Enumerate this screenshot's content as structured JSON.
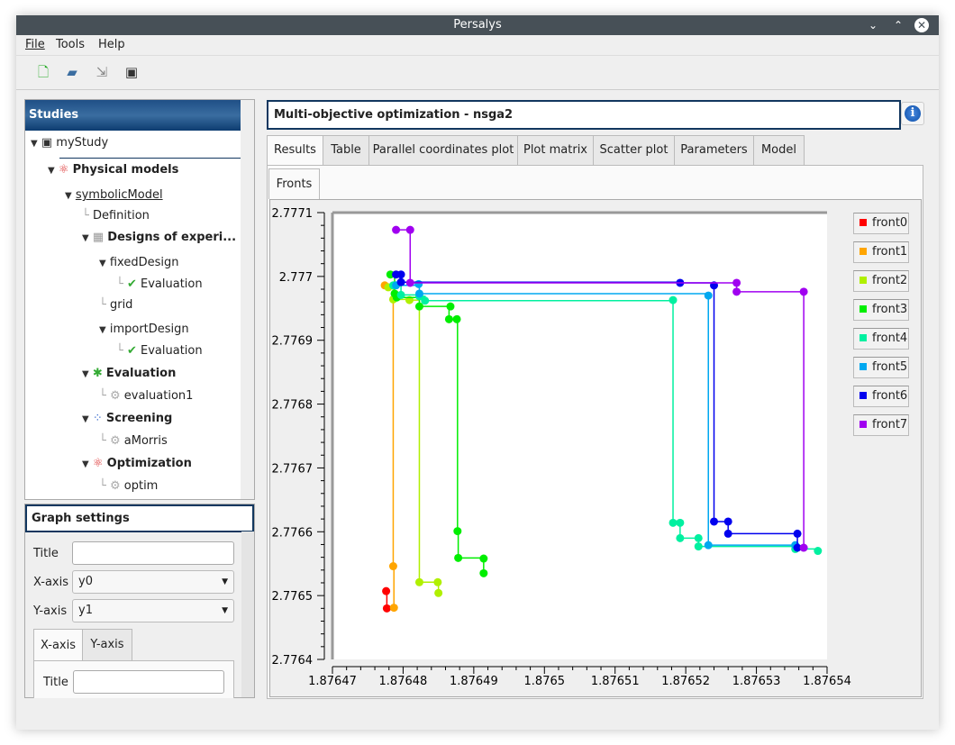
{
  "window": {
    "title": "Persalys"
  },
  "menu": [
    "File",
    "Tools",
    "Help"
  ],
  "toolbar": [
    "new-study-icon",
    "open-study-icon",
    "import-icon",
    "save-icon"
  ],
  "studies": {
    "header": "Studies",
    "items": [
      {
        "label": "myStudy",
        "level": 0,
        "icon": "save-icon",
        "bold": false
      },
      {
        "label": "Physical models",
        "level": 1,
        "icon": "atom-icon",
        "bold": true
      },
      {
        "label": "symbolicModel",
        "level": 2,
        "icon": "",
        "bold": false,
        "underline": true
      },
      {
        "label": "Definition",
        "level": 3,
        "icon": "",
        "bold": false
      },
      {
        "label": "Designs of experi...",
        "level": 3,
        "icon": "table-icon",
        "bold": true
      },
      {
        "label": "fixedDesign",
        "level": 4,
        "icon": "",
        "bold": false
      },
      {
        "label": "Evaluation",
        "level": 5,
        "icon": "check-icon",
        "bold": false
      },
      {
        "label": "grid",
        "level": 4,
        "icon": "",
        "bold": false
      },
      {
        "label": "importDesign",
        "level": 4,
        "icon": "",
        "bold": false
      },
      {
        "label": "Evaluation",
        "level": 5,
        "icon": "check-icon",
        "bold": false
      },
      {
        "label": "Evaluation",
        "level": 3,
        "icon": "evaluation-icon",
        "bold": true
      },
      {
        "label": "evaluation1",
        "level": 4,
        "icon": "gear-icon",
        "bold": false
      },
      {
        "label": "Screening",
        "level": 3,
        "icon": "screening-icon",
        "bold": true
      },
      {
        "label": "aMorris",
        "level": 4,
        "icon": "gear-icon",
        "bold": false
      },
      {
        "label": "Optimization",
        "level": 3,
        "icon": "atom-icon",
        "bold": true
      },
      {
        "label": "optim",
        "level": 4,
        "icon": "gear-icon",
        "bold": false
      }
    ]
  },
  "graph_settings": {
    "header": "Graph settings",
    "title_label": "Title",
    "title_value": "",
    "xaxis_label": "X-axis",
    "xaxis_value": "y0",
    "yaxis_label": "Y-axis",
    "yaxis_value": "y1",
    "tabs": [
      "X-axis",
      "Y-axis"
    ],
    "axis_title_label": "Title",
    "axis_title_value": ""
  },
  "main": {
    "title": "Multi-objective optimization - nsga2",
    "tabs": [
      "Results",
      "Table",
      "Parallel coordinates plot",
      "Plot matrix",
      "Scatter plot",
      "Parameters",
      "Model"
    ],
    "subtabs": [
      "Fronts"
    ]
  },
  "chart_data": {
    "type": "scatter",
    "xlim": [
      1.87647,
      1.87654
    ],
    "ylim": [
      2.7764,
      2.7771
    ],
    "xticks": [
      "1.87647",
      "1.87648",
      "1.87649",
      "1.8765",
      "1.87651",
      "1.87652",
      "1.87653",
      "1.87654"
    ],
    "yticks": [
      "2.7771",
      "2.777",
      "2.7769",
      "2.7768",
      "2.7767",
      "2.7766",
      "2.7765",
      "2.7764"
    ],
    "legend_placement": "right",
    "grid": false,
    "series": [
      {
        "name": "front0",
        "color": "#ff0000",
        "points": [
          [
            1.8764776,
            2.776507
          ],
          [
            1.8764777,
            2.77648
          ]
        ]
      },
      {
        "name": "front1",
        "color": "#ffa500",
        "points": [
          [
            1.8764774,
            2.776986
          ],
          [
            1.8764786,
            2.776546
          ],
          [
            1.8764787,
            2.776481
          ]
        ]
      },
      {
        "name": "front2",
        "color": "#b0f000",
        "points": [
          [
            1.8764779,
            2.776983
          ],
          [
            1.8764786,
            2.776964
          ],
          [
            1.8764809,
            2.776963
          ],
          [
            1.8764823,
            2.776521
          ],
          [
            1.8764849,
            2.776521
          ],
          [
            1.876485,
            2.776504
          ]
        ]
      },
      {
        "name": "front3",
        "color": "#00ee00",
        "points": [
          [
            1.8764782,
            2.777003
          ],
          [
            1.8764788,
            2.776973
          ],
          [
            1.8764791,
            2.776967
          ],
          [
            1.8764823,
            2.776953
          ],
          [
            1.8764867,
            2.776953
          ],
          [
            1.8764865,
            2.776933
          ],
          [
            1.8764876,
            2.776933
          ],
          [
            1.8764877,
            2.776601
          ],
          [
            1.8764878,
            2.776559
          ],
          [
            1.8764914,
            2.776558
          ],
          [
            1.8764914,
            2.776535
          ]
        ]
      },
      {
        "name": "front4",
        "color": "#00f0a0",
        "points": [
          [
            1.8764786,
            2.776986
          ],
          [
            1.8764797,
            2.776971
          ],
          [
            1.8764823,
            2.776969
          ],
          [
            1.8764831,
            2.776962
          ],
          [
            1.8765182,
            2.776963
          ],
          [
            1.8765182,
            2.776614
          ],
          [
            1.8765192,
            2.776614
          ],
          [
            1.8765192,
            2.77659
          ],
          [
            1.8765218,
            2.77659
          ],
          [
            1.8765218,
            2.776577
          ],
          [
            1.8765355,
            2.776573
          ],
          [
            1.8765387,
            2.77657
          ]
        ]
      },
      {
        "name": "front5",
        "color": "#00a8f0",
        "points": [
          [
            1.876479,
            2.776986
          ],
          [
            1.8764822,
            2.776988
          ],
          [
            1.8764823,
            2.776973
          ],
          [
            1.8765232,
            2.77697
          ],
          [
            1.8765232,
            2.776579
          ],
          [
            1.8765355,
            2.776579
          ]
        ]
      },
      {
        "name": "front6",
        "color": "#0000ee",
        "points": [
          [
            1.876479,
            2.777003
          ],
          [
            1.8764797,
            2.777003
          ],
          [
            1.8764797,
            2.776991
          ],
          [
            1.8765192,
            2.77699
          ],
          [
            1.876524,
            2.776986
          ],
          [
            1.876524,
            2.776616
          ],
          [
            1.876526,
            2.776616
          ],
          [
            1.876526,
            2.776597
          ],
          [
            1.8765358,
            2.776597
          ],
          [
            1.8765358,
            2.776575
          ]
        ]
      },
      {
        "name": "front7",
        "color": "#a000f0",
        "points": [
          [
            1.876479,
            2.777073
          ],
          [
            1.876481,
            2.777073
          ],
          [
            1.876481,
            2.77699
          ],
          [
            1.8765272,
            2.77699
          ],
          [
            1.8765272,
            2.776976
          ],
          [
            1.8765367,
            2.776976
          ],
          [
            1.8765367,
            2.776575
          ]
        ]
      }
    ]
  }
}
